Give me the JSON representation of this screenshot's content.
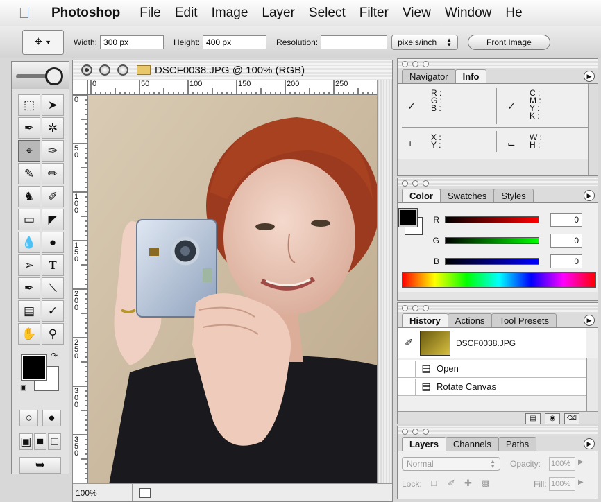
{
  "menubar": {
    "app_name": "Photoshop",
    "items": [
      "File",
      "Edit",
      "Image",
      "Layer",
      "Select",
      "Filter",
      "View",
      "Window",
      "He"
    ]
  },
  "options": {
    "width_label": "Width:",
    "width_value": "300 px",
    "height_label": "Height:",
    "height_value": "400 px",
    "resolution_label": "Resolution:",
    "resolution_value": "",
    "units_value": "pixels/inch",
    "front_image_label": "Front Image"
  },
  "document": {
    "title": "DSCF0038.JPG @ 100% (RGB)",
    "zoom": "100%",
    "ruler_h": [
      "0",
      "50",
      "100",
      "150",
      "200",
      "250"
    ],
    "ruler_v": [
      "0",
      "5 0",
      "1 0 0",
      "1 5 0",
      "2 0 0",
      "2 5 0",
      "3 0 0",
      "3 5 0"
    ]
  },
  "info_palette": {
    "tabs": [
      "Navigator",
      "Info"
    ],
    "active_tab": "Info",
    "rgb_labels": "R :\nG :\nB :",
    "cmyk_labels": "C :\nM :\nY :\nK :",
    "xy_labels": "X :\nY :",
    "wh_labels": "W :\nH :"
  },
  "color_palette": {
    "tabs": [
      "Color",
      "Swatches",
      "Styles"
    ],
    "active_tab": "Color",
    "channels": [
      {
        "label": "R",
        "value": "0",
        "color": "#ff0000"
      },
      {
        "label": "G",
        "value": "0",
        "color": "#00ff00"
      },
      {
        "label": "B",
        "value": "0",
        "color": "#0000ff"
      }
    ]
  },
  "history_palette": {
    "tabs": [
      "History",
      "Actions",
      "Tool Presets"
    ],
    "active_tab": "History",
    "snapshot_name": "DSCF0038.JPG",
    "items": [
      "Open",
      "Rotate Canvas"
    ]
  },
  "layers_palette": {
    "tabs": [
      "Layers",
      "Channels",
      "Paths"
    ],
    "active_tab": "Layers",
    "blend_mode": "Normal",
    "opacity_label": "Opacity:",
    "opacity_value": "100%",
    "lock_label": "Lock:",
    "fill_label": "Fill:",
    "fill_value": "100%"
  },
  "colors": {
    "foreground": "#000000",
    "background": "#ffffff"
  }
}
